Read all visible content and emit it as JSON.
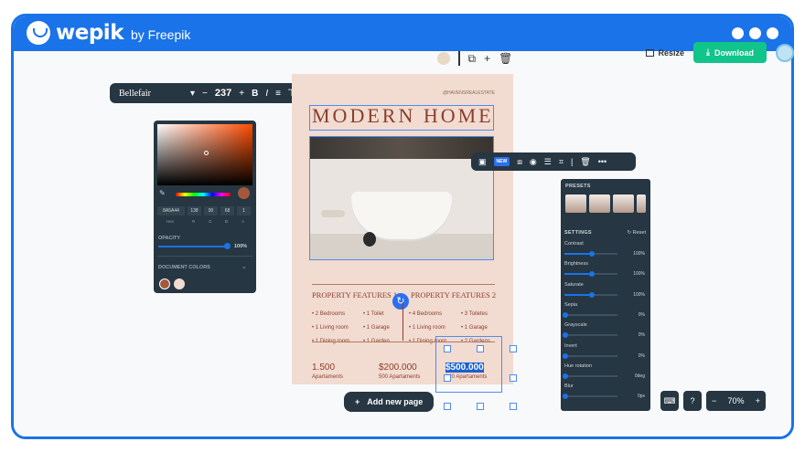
{
  "brand": {
    "name": "wepik",
    "by": "by Freepik"
  },
  "header": {
    "resize": "Resize",
    "download": "Download"
  },
  "textbar": {
    "font": "Bellefair",
    "size": "237"
  },
  "poster": {
    "handle": "@HAVENSREALESTATE",
    "title": "MODERN HOME",
    "features1": "PROPERTY FEATURES 1",
    "features2": "PROPERTY FEATURES 2",
    "col1": [
      "• 2 Bedrooms",
      "• 1 Living room",
      "• 1 Dining room"
    ],
    "col2": [
      "• 1 Toilet",
      "• 1 Garage",
      "• 1 Garden"
    ],
    "col3": [
      "• 4 Bedrooms",
      "• 1 Living room",
      "• 1 Dining room"
    ],
    "col4": [
      "• 3 Toiletes",
      "• 1 Garage",
      "• 2 Gardens"
    ],
    "prices": [
      {
        "value": "1.500",
        "label": "Apartaments"
      },
      {
        "value": "$200.000",
        "label": "500 Apartaments"
      },
      {
        "value": "$500.000",
        "label": "120 Apartaments"
      }
    ]
  },
  "addpage": "Add new page",
  "color_panel": {
    "hex": "8A5A44",
    "r": "138",
    "g": "90",
    "b": "68",
    "a": "1",
    "labels": [
      "Hex",
      "R",
      "G",
      "B",
      "A"
    ],
    "opacity_label": "OPACITY",
    "opacity": "100%",
    "doc_colors": "DOCUMENT COLORS",
    "selected_color": "#a4583b"
  },
  "settings": {
    "presets": "PRESETS",
    "settings": "SETTINGS",
    "reset": "Reset",
    "rows": [
      {
        "name": "Contrast",
        "value": "100%",
        "level": 0.5
      },
      {
        "name": "Brightness",
        "value": "100%",
        "level": 0.5
      },
      {
        "name": "Saturate",
        "value": "100%",
        "level": 0.5
      },
      {
        "name": "Sepia",
        "value": "0%",
        "level": 0
      },
      {
        "name": "Grayscale",
        "value": "0%",
        "level": 0
      },
      {
        "name": "Invert",
        "value": "0%",
        "level": 0
      },
      {
        "name": "Hue rotation",
        "value": "0deg",
        "level": 0
      },
      {
        "name": "Blur",
        "value": "0px",
        "level": 0
      }
    ]
  },
  "zoom": "70%",
  "newtag": "NEW"
}
